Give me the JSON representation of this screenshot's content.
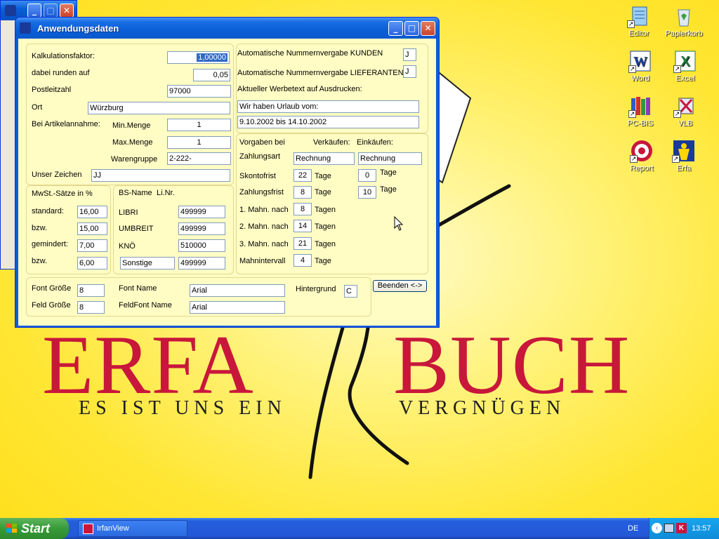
{
  "brand": {
    "left": "ERFA",
    "right": "BUCH",
    "slogan_left": "ES IST UNS EIN",
    "slogan_right": "VERGNÜGEN"
  },
  "desktop_icons": [
    {
      "name": "notepad",
      "label": "Editor"
    },
    {
      "name": "recycle-bin",
      "label": "Papierkorb"
    },
    {
      "name": "word",
      "label": "Word"
    },
    {
      "name": "excel",
      "label": "Excel"
    },
    {
      "name": "pc-bis",
      "label": "PC-BIS"
    },
    {
      "name": "vlb",
      "label": "VLB"
    },
    {
      "name": "report",
      "label": "Report"
    },
    {
      "name": "erfa",
      "label": "Erfa"
    }
  ],
  "window": {
    "title": "Anwendungsdaten"
  },
  "left_top": {
    "kalk_label": "Kalkulationsfaktor:",
    "kalk_value": "1,00000",
    "runden_label": "dabei runden auf",
    "runden_value": "0,05",
    "plz_label": "Postleitzahl",
    "plz_value": "97000",
    "ort_label": "Ort",
    "ort_value": "Würzburg",
    "artikel_label": "Bei Artikelannahme:",
    "min_label": "Min.Menge",
    "min_value": "1",
    "max_label": "Max.Menge",
    "max_value": "1",
    "wg_label": "Warengruppe",
    "wg_value": "2-222-",
    "zeichen_label": "Unser Zeichen",
    "zeichen_value": "JJ"
  },
  "mwst": {
    "title": "MwSt.-Sätze in %",
    "rows": [
      {
        "label": "standard:",
        "value": "16,00"
      },
      {
        "label": "bzw.",
        "value": "15,00"
      },
      {
        "label": "gemindert:",
        "value": "7,00"
      },
      {
        "label": "bzw.",
        "value": "6,00"
      }
    ]
  },
  "bs": {
    "header_name": "BS-Name",
    "header_nr": "Li.Nr.",
    "rows": [
      {
        "name": "LIBRI",
        "nr": "499999"
      },
      {
        "name": "UMBREIT",
        "nr": "499999"
      },
      {
        "name": "KNÖ",
        "nr": "510000"
      },
      {
        "name": "Sonstige",
        "nr": "499999"
      }
    ]
  },
  "right_top": {
    "kunden_label": "Automatische Nummernvergabe KUNDEN",
    "kunden_value": "J",
    "lief_label": "Automatische Nummernvergabe LIEFERANTEN",
    "lief_value": "J",
    "werbe_label": "Aktueller Werbetext auf Ausdrucken:",
    "werbe_line1": "Wir haben Urlaub vom:",
    "werbe_line2": "9.10.2002 bis 14.10.2002"
  },
  "vorgaben": {
    "title": "Vorgaben bei",
    "col_verkauf": "Verkäufen:",
    "col_einkauf": "Einkäufen:",
    "zahlungsart_label": "Zahlungsart",
    "zahlungsart_verkauf": "Rechnung",
    "zahlungsart_einkauf": "Rechnung",
    "skonto_label": "Skontofrist",
    "skonto_verkauf": "22",
    "skonto_einkauf": "0",
    "zahlfrist_label": "Zahlungsfrist",
    "zahlfrist_verkauf": "8",
    "zahlfrist_einkauf": "10",
    "tage": "Tage",
    "tagen": "Tagen",
    "mahn1_label": "1. Mahn. nach",
    "mahn1_value": "8",
    "mahn2_label": "2. Mahn. nach",
    "mahn2_value": "14",
    "mahn3_label": "3. Mahn. nach",
    "mahn3_value": "21",
    "mahnint_label": "Mahnintervall",
    "mahnint_value": "4"
  },
  "fonts": {
    "font_size_label": "Font Größe",
    "font_size_value": "8",
    "feld_size_label": "Feld Größe",
    "feld_size_value": "8",
    "font_name_label": "Font Name",
    "font_name_value": "Arial",
    "feldfont_label": "FeldFont Name",
    "feldfont_value": "Arial",
    "hintergrund_label": "Hintergrund",
    "hintergrund_value": "C"
  },
  "beenden_label": "Beenden <->",
  "taskbar": {
    "start": "Start",
    "task": "IrfanView",
    "lang": "DE",
    "clock": "13:57"
  }
}
